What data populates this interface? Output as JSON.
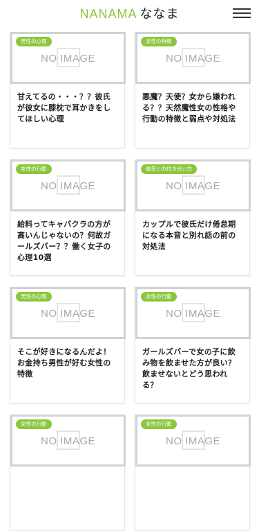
{
  "header": {
    "logo_en": "NANAMA",
    "logo_ja": "ななま"
  },
  "cards": [
    {
      "category": "男性の心理",
      "image_text": "NO IMAGE",
      "title": "甘えてるの・・・？？彼氏が彼女に膝枕で耳かきをしてほしい心理"
    },
    {
      "category": "女性の特徴",
      "image_text": "NO IMAGE",
      "title": "悪魔？天使？女から嫌われる？？天然魔性女の性格や行動の特徴と弱点や対処法"
    },
    {
      "category": "女性の行動",
      "image_text": "NO IMAGE",
      "title": "給料ってキャバクラの方が高いんじゃないの？何故ガールズバー？？働く女子の心理10選"
    },
    {
      "category": "彼氏との付き合い方",
      "image_text": "NO IMAGE",
      "title": "カップルで彼氏だけ倦怠期になる本音と別れ話の前の対処法"
    },
    {
      "category": "男性の心理",
      "image_text": "NO IMAGE",
      "title": "そこが好きになるんだよ！お金持ち男性が好む女性の特徴"
    },
    {
      "category": "女性の行動",
      "image_text": "NO IMAGE",
      "title": "ガールズバーで女の子に飲み物を飲ませた方が良い？飲ませないとどう思われる？"
    },
    {
      "category": "女性の行動",
      "image_text": "NO IMAGE",
      "title": ""
    },
    {
      "category": "女性の行動",
      "image_text": "NO IMAGE",
      "title": ""
    }
  ]
}
